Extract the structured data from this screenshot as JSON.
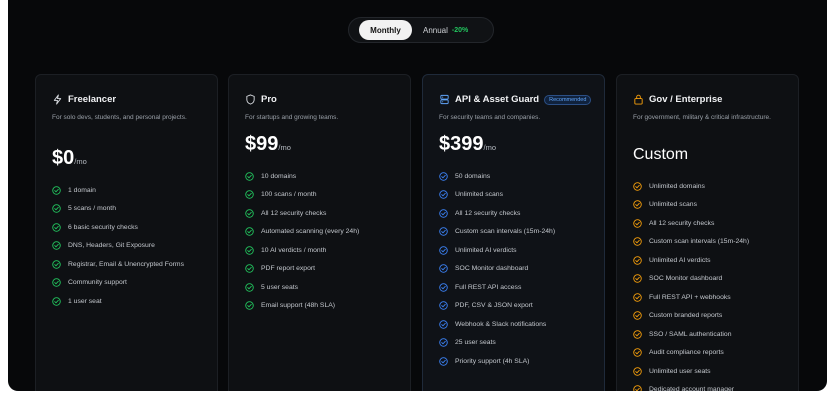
{
  "billing_toggle": {
    "monthly_label": "Monthly",
    "annual_label": "Annual",
    "annual_discount": "-20%"
  },
  "colors": {
    "background": "#07080a",
    "card": "#0e1013",
    "check_green": "#22c55e",
    "check_blue": "#3b82f6",
    "check_amber": "#f59e0b"
  },
  "plans": [
    {
      "name": "Freelancer",
      "icon": "lightning-icon",
      "description": "For solo devs, students, and personal projects.",
      "price": "$0",
      "price_unit": "/mo",
      "features": [
        "1 domain",
        "5 scans / month",
        "6 basic security checks",
        "DNS, Headers, Git Exposure",
        "Registrar, Email & Unencrypted Forms",
        "Community support",
        "1 user seat"
      ]
    },
    {
      "name": "Pro",
      "icon": "shield-icon",
      "description": "For startups and growing teams.",
      "price": "$99",
      "price_unit": "/mo",
      "features": [
        "10 domains",
        "100 scans / month",
        "All 12 security checks",
        "Automated scanning (every 24h)",
        "10 AI verdicts / month",
        "PDF report export",
        "5 user seats",
        "Email support (48h SLA)"
      ]
    },
    {
      "name": "API & Asset Guard",
      "icon": "server-icon",
      "badge": "Recommended",
      "description": "For security teams and companies.",
      "price": "$399",
      "price_unit": "/mo",
      "features": [
        "50 domains",
        "Unlimited scans",
        "All 12 security checks",
        "Custom scan intervals (15m-24h)",
        "Unlimited AI verdicts",
        "SOC Monitor dashboard",
        "Full REST API access",
        "PDF, CSV & JSON export",
        "Webhook & Slack notifications",
        "25 user seats",
        "Priority support (4h SLA)"
      ]
    },
    {
      "name": "Gov / Enterprise",
      "icon": "lock-icon",
      "description": "For government, military & critical infrastructure.",
      "price": "Custom",
      "features": [
        "Unlimited domains",
        "Unlimited scans",
        "All 12 security checks",
        "Custom scan intervals (15m-24h)",
        "Unlimited AI verdicts",
        "SOC Monitor dashboard",
        "Full REST API + webhooks",
        "Custom branded reports",
        "SSO / SAML authentication",
        "Audit compliance reports",
        "Unlimited user seats",
        "Dedicated account manager"
      ]
    }
  ]
}
